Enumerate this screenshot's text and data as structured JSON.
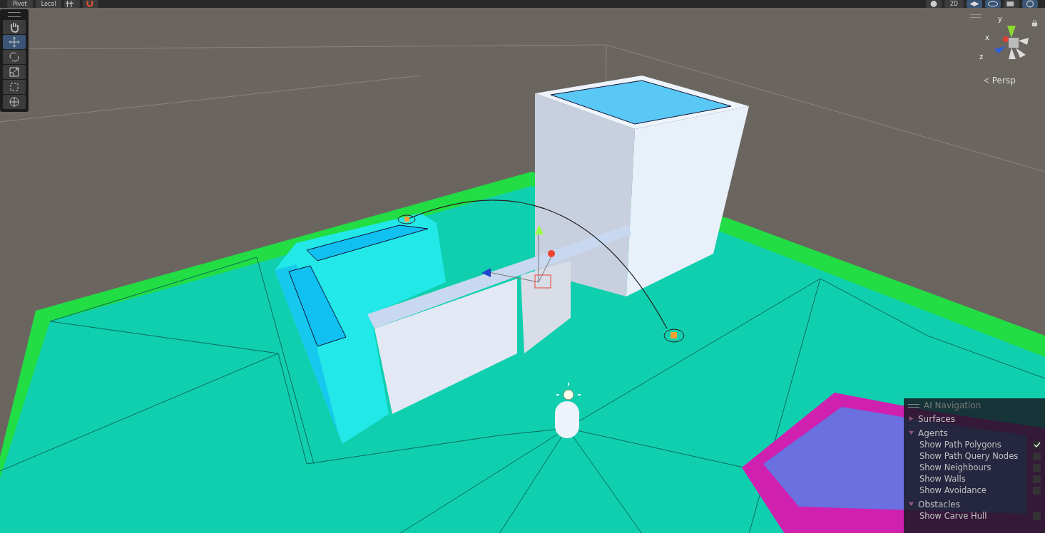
{
  "toolbar": {
    "left_buttons": [
      {
        "label": "Pivot"
      },
      {
        "label": "Local"
      }
    ],
    "right_buttons": [
      {
        "label": "2D"
      }
    ]
  },
  "tools": [
    {
      "kind": "hand",
      "selected": false
    },
    {
      "kind": "move",
      "selected": true
    },
    {
      "kind": "rotate",
      "selected": false
    },
    {
      "kind": "scale",
      "selected": false
    },
    {
      "kind": "rect",
      "selected": false
    },
    {
      "kind": "transform",
      "selected": false
    }
  ],
  "gizmo": {
    "axes": [
      "x",
      "y",
      "z"
    ],
    "projection": "Persp"
  },
  "overlay": {
    "title": "AI Navigation",
    "sections": [
      {
        "label": "Surfaces",
        "expanded": false
      },
      {
        "label": "Agents",
        "expanded": true,
        "options": [
          {
            "label": "Show Path Polygons",
            "checked": true
          },
          {
            "label": "Show Path Query Nodes",
            "checked": false
          },
          {
            "label": "Show Neighbours",
            "checked": false
          },
          {
            "label": "Show Walls",
            "checked": false
          },
          {
            "label": "Show Avoidance",
            "checked": false
          }
        ]
      },
      {
        "label": "Obstacles",
        "expanded": true,
        "options": [
          {
            "label": "Show Carve Hull",
            "checked": false
          }
        ]
      }
    ]
  }
}
